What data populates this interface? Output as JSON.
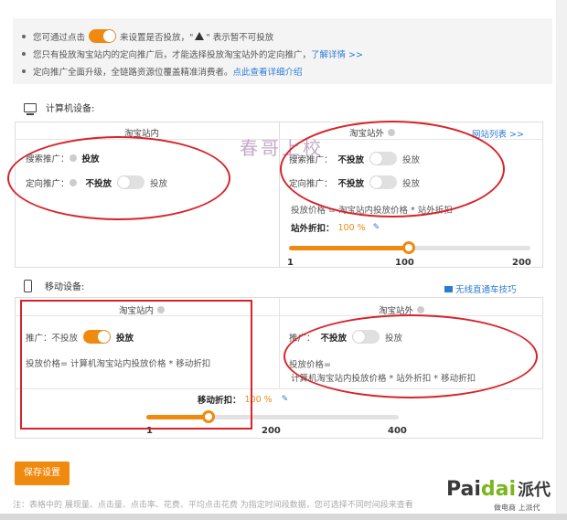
{
  "notice": {
    "line1_part1": "您可通过点击",
    "line1_part2": "来设置是否投放，\"",
    "line1_part3": "\" 表示暂不可投放",
    "line2_text": "您只有投放淘宝站内的定向推广后，才能选择投放淘宝站外的定向推广，",
    "line2_link": "了解详情 >>",
    "line3_text": "定向推广全面升级，全链路资源位覆盖精准消费者。",
    "line3_link": "点此查看详细介绍"
  },
  "pc": {
    "heading": "计算机设备:",
    "inside": {
      "title": "淘宝站内",
      "search_label": "搜索推广：",
      "search_value": "投放",
      "directed_label": "定向推广：",
      "directed_off": "不投放",
      "directed_on": "投放"
    },
    "outside": {
      "title": "淘宝站外",
      "site_list_link": "网站列表 >>",
      "search_label": "搜索推广：",
      "search_off": "不投放",
      "search_on": "投放",
      "directed_label": "定向推广：",
      "directed_off": "不投放",
      "directed_on": "投放",
      "price_formula": "投放价格 = 淘宝站内投放价格 * 站外折扣",
      "discount_label": "站外折扣：",
      "discount_value": "100 %",
      "slider": {
        "min_label": "1",
        "mid_label": "100",
        "max_label": "200",
        "value": 100,
        "min": 1,
        "max": 200
      }
    }
  },
  "mobile": {
    "heading": "移动设备:",
    "tips_link": "无线直通车技巧",
    "inside": {
      "title": "淘宝站内",
      "promo_label": "推广：",
      "promo_off": "不投放",
      "promo_on": "投放",
      "price_formula": "投放价格= 计算机淘宝站内投放价格 * 移动折扣"
    },
    "outside": {
      "title": "淘宝站外",
      "promo_label": "推广：",
      "promo_off": "不投放",
      "promo_on": "投放",
      "price_formula_1": "投放价格=",
      "price_formula_2": "计算机淘宝站内投放价格 * 站外折扣 * 移动折扣"
    },
    "discount_label": "移动折扣：",
    "discount_value": "100 %",
    "slider": {
      "min_label": "1",
      "mid_label": "200",
      "max_label": "400",
      "value": 100,
      "min": 1,
      "max": 400
    }
  },
  "save_button": "保存设置",
  "footer_note": "注：表格中的 展现量、点击量、点击率、花费、平均点击花费 为指定时间段数据，您可选择不同时间段来查看",
  "watermark": "春哥上校",
  "brand": {
    "part1": "Pai",
    "part2": "dai",
    "cn": "派代",
    "sub": "做电商 上派代"
  },
  "colors": {
    "accent": "#f08a0f",
    "link": "#2b7bd6",
    "annotation_red": "#d8232a"
  }
}
